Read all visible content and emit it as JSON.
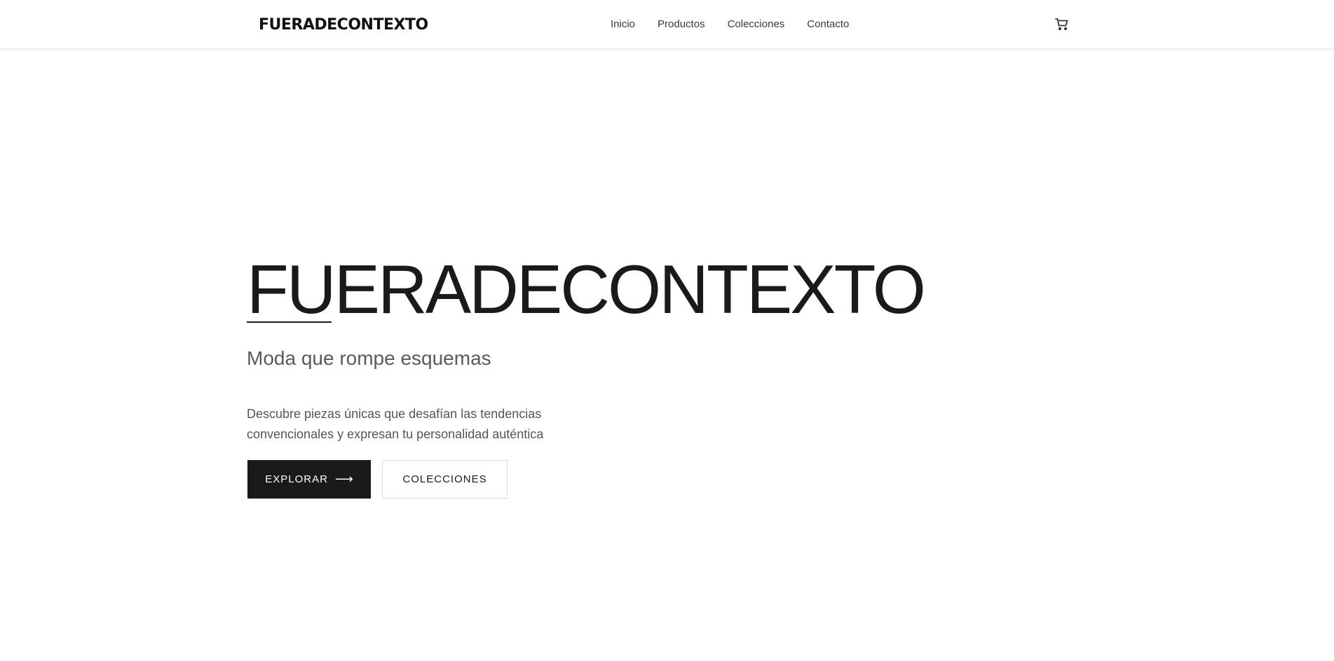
{
  "header": {
    "brand": "FUERADECONTEXTO",
    "nav": [
      "Inicio",
      "Productos",
      "Colecciones",
      "Contacto"
    ],
    "cart_icon": "cart-icon"
  },
  "hero": {
    "title": "FUERADECONTEXTO",
    "subtitle": "Moda que rompe esquemas",
    "description": "Descubre piezas únicas que desafían las tendencias convencionales y expresan tu personalidad auténtica",
    "primary_button": "EXPLORAR",
    "primary_button_icon": "arrow-right-icon",
    "secondary_button": "COLECCIONES"
  },
  "colors": {
    "text": "#1a1a1a",
    "muted": "#5a5a5a",
    "background": "#ffffff",
    "primary_button_bg": "#1a1a1a"
  }
}
